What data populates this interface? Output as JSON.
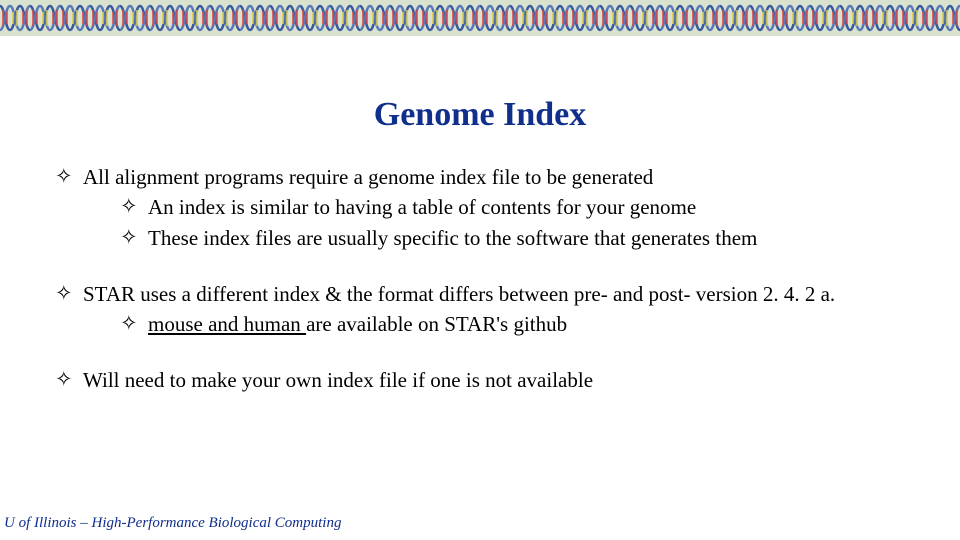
{
  "title": "Genome Index",
  "bullets": {
    "b1_1": "All alignment programs require a genome index file to be generated",
    "b1_1_a": "An index is similar to having a table of contents for your genome",
    "b1_1_b": "These index files are usually specific to the software that generates them",
    "b1_2_pre": "STAR uses a different index & the format differs between pre- and post- version 2. 4. 2 a.",
    "b1_2_a_link": "mouse and human ",
    "b1_2_a_rest": "are available on STAR's github",
    "b1_3": "Will need to make your own index file if one is not available"
  },
  "bullet_glyph": "✧",
  "footer": "U of Illinois – High-Performance Biological Computing"
}
